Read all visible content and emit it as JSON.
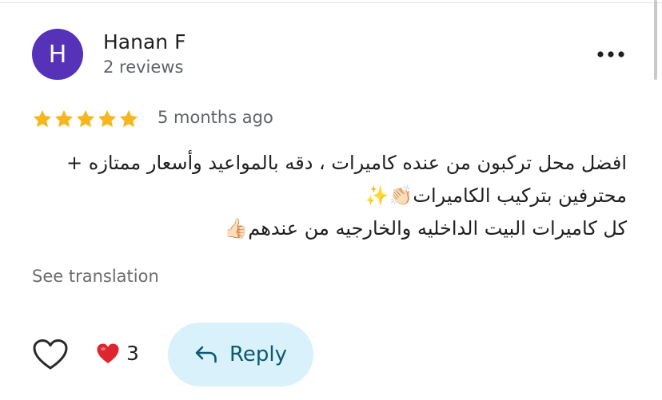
{
  "review": {
    "author": {
      "initial": "H",
      "name": "Hanan F",
      "meta": "2 reviews",
      "avatar_color": "#5632b9"
    },
    "rating": 5,
    "date": "5 months ago",
    "text_lines": [
      "افضل محل تركبون من عنده كاميرات ، دقه بالمواعيد وأسعار ممتازه +",
      "محترفين بتركيب الكاميرات👏🏻✨",
      "كل كاميرات البيت الداخليه والخارجيه من عندهم👍🏻"
    ],
    "see_translation_label": "See translation"
  },
  "actions": {
    "reaction_count": "3",
    "reply_label": "Reply",
    "more_icon": "more-horizontal-icon",
    "like_icon": "heart-outline-icon",
    "reaction_icon": "red-heart-emoji",
    "reply_icon": "reply-arrow-icon"
  },
  "colors": {
    "star": "#f6b61e",
    "reply_bg": "#d9f1fa",
    "reply_text": "#0b5a6e",
    "heart": "#e0242e"
  }
}
